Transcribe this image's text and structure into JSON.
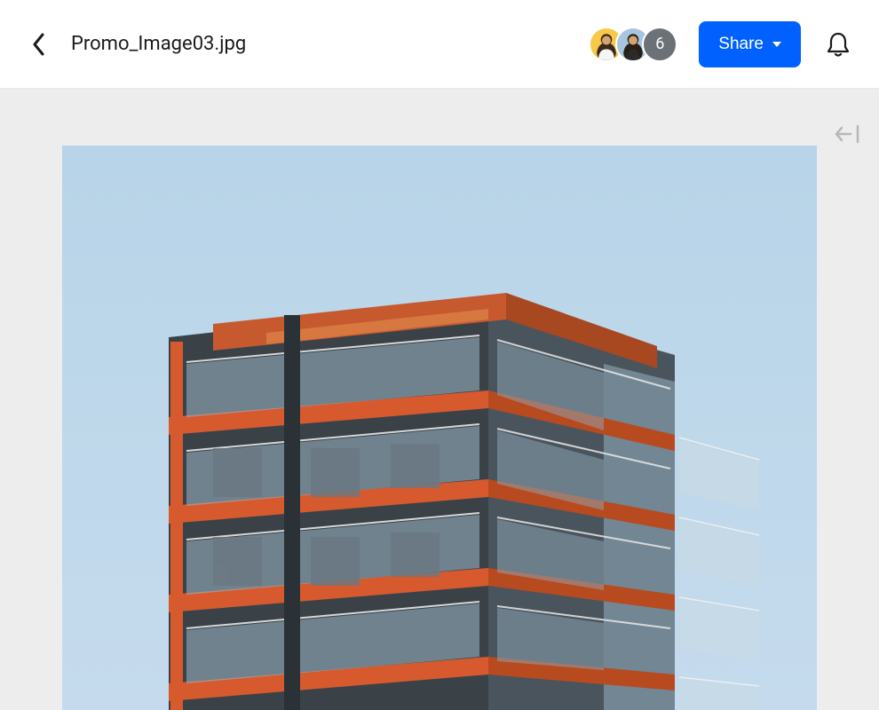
{
  "header": {
    "filename": "Promo_Image03.jpg",
    "share_label": "Share",
    "overflow_count": "6"
  },
  "avatars": [
    {
      "name": "user-avatar-1",
      "bg_color": "#f7c948"
    },
    {
      "name": "user-avatar-2",
      "bg_color": "#a8c5e0"
    }
  ],
  "image": {
    "description": "modern-building-photo"
  }
}
